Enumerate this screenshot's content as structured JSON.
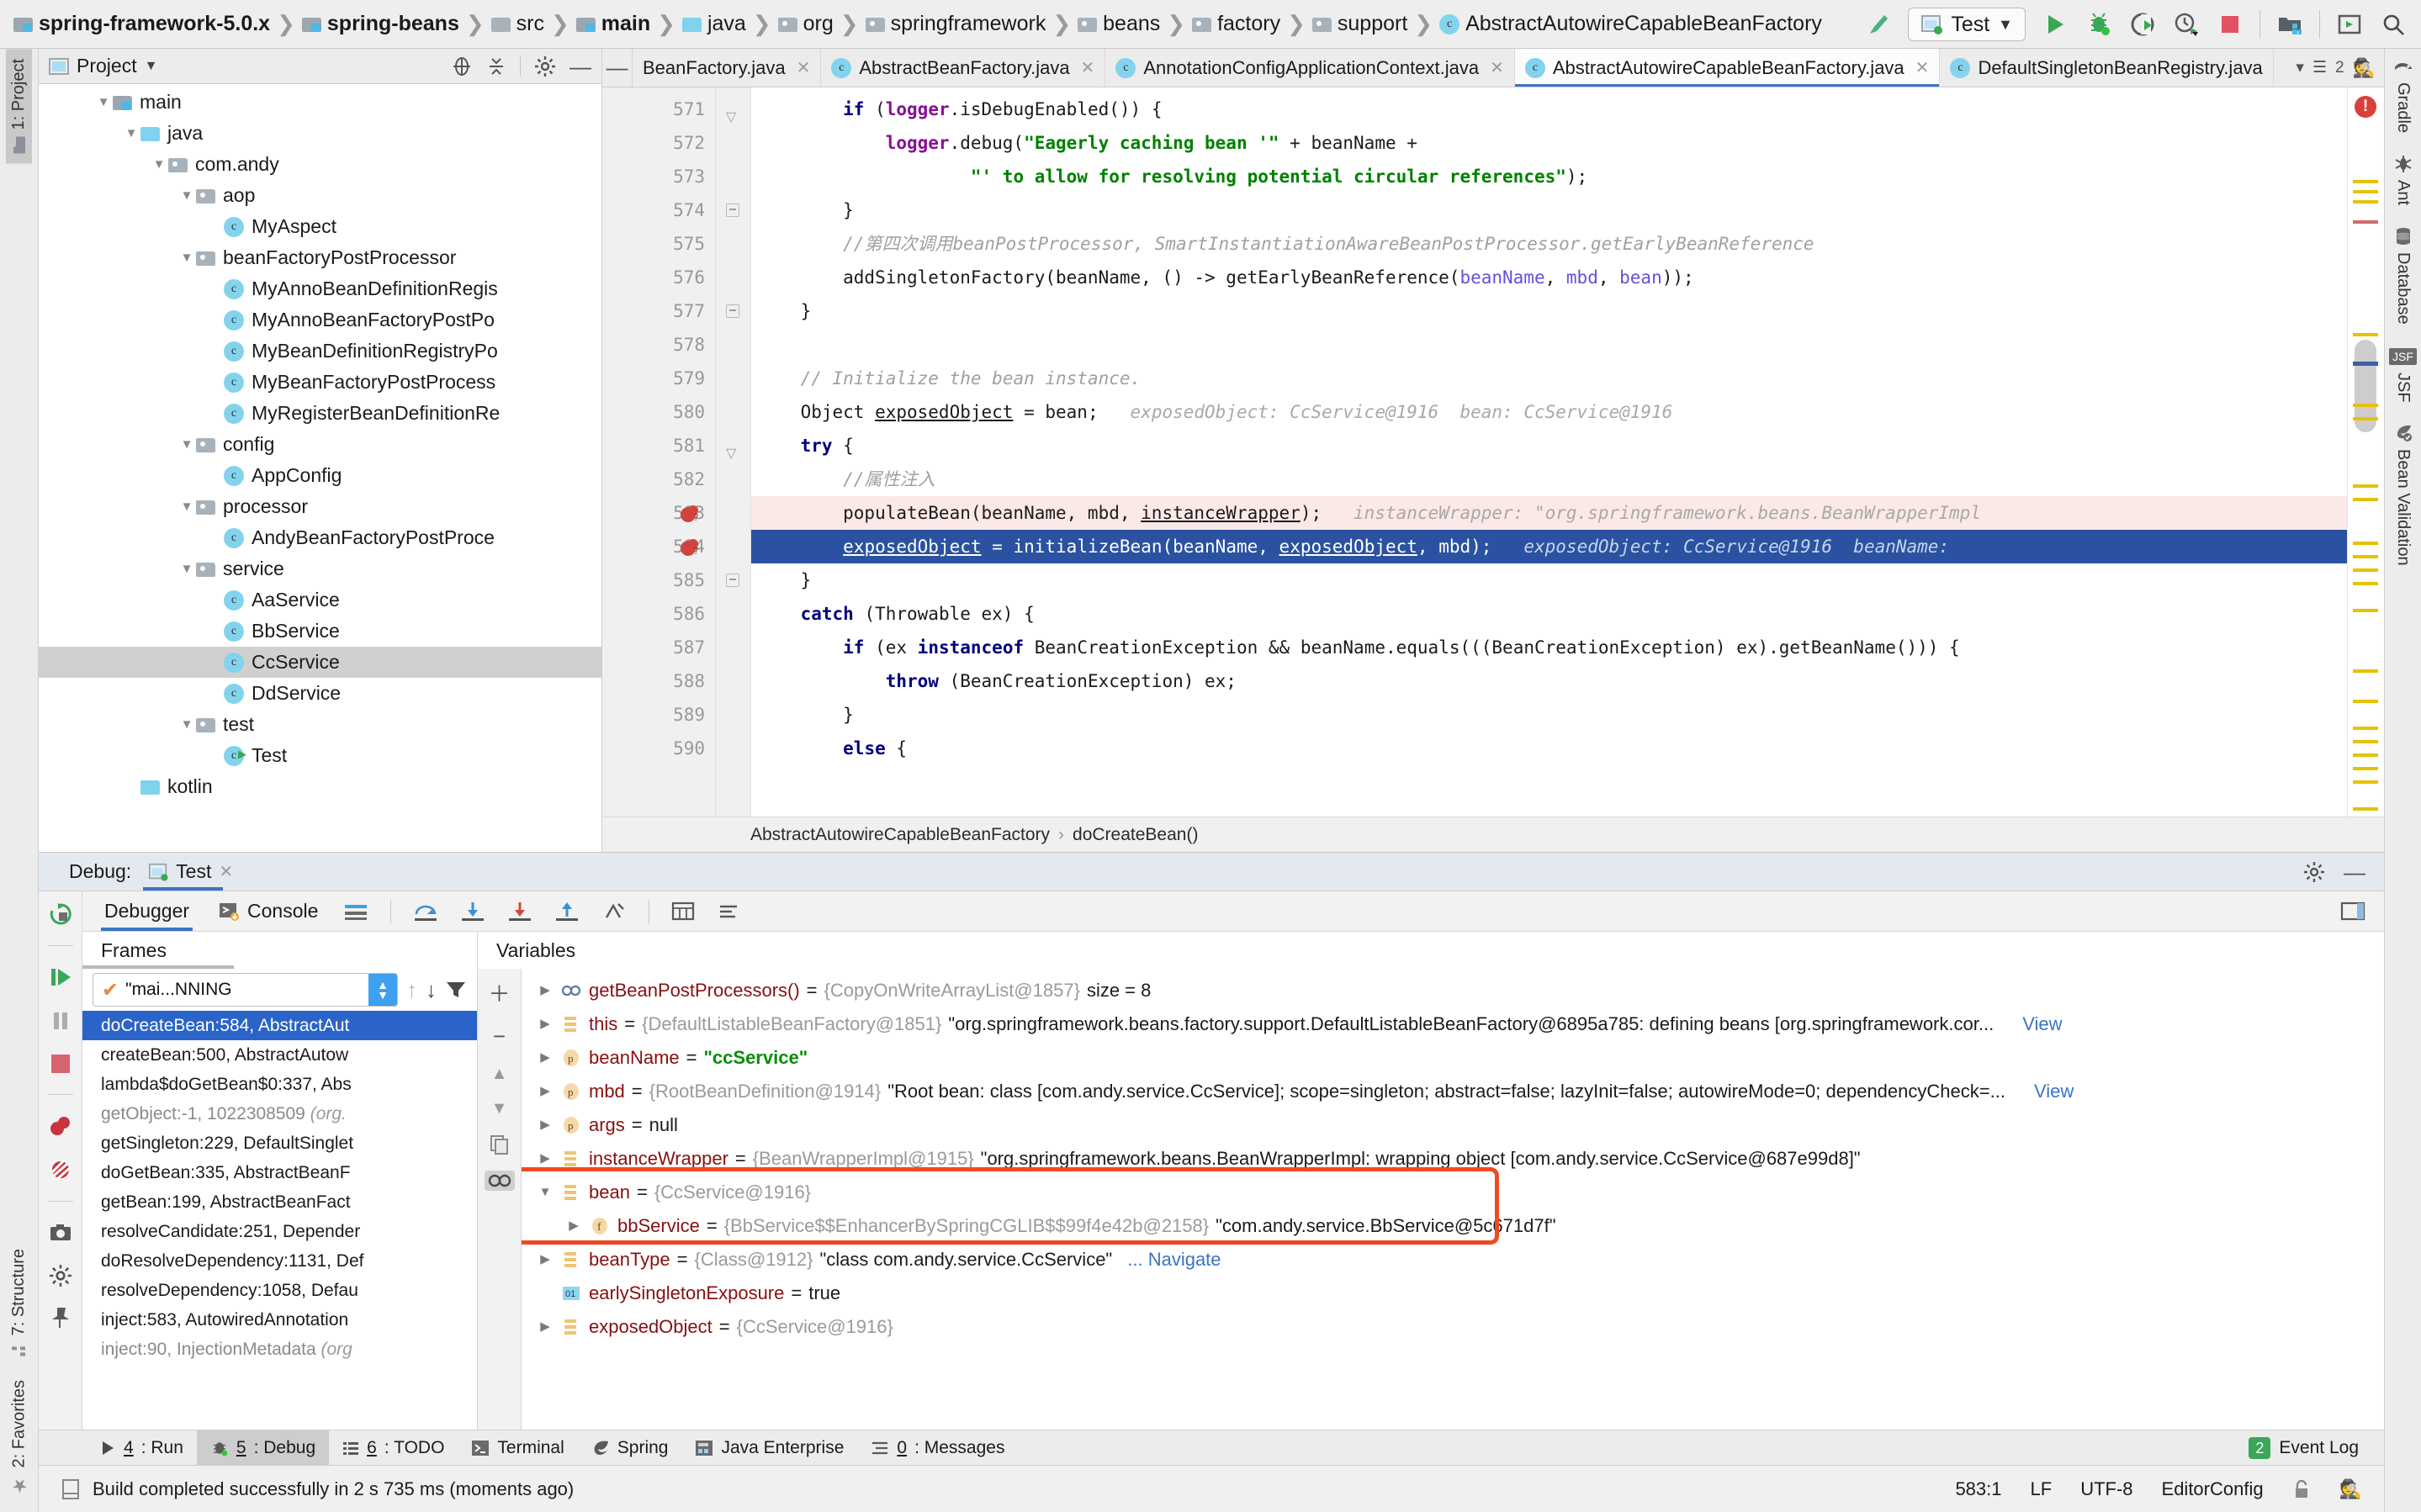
{
  "navbar": {
    "breadcrumbs": [
      {
        "label": "spring-framework-5.0.x",
        "icon": "module-folder-icon",
        "bold": true
      },
      {
        "label": "spring-beans",
        "icon": "module-folder-icon",
        "bold": true
      },
      {
        "label": "src",
        "icon": "folder-icon",
        "bold": false
      },
      {
        "label": "main",
        "icon": "module-folder-icon",
        "bold": true
      },
      {
        "label": "java",
        "icon": "source-folder-icon",
        "bold": false
      },
      {
        "label": "org",
        "icon": "package-folder-icon",
        "bold": false
      },
      {
        "label": "springframework",
        "icon": "package-folder-icon",
        "bold": false
      },
      {
        "label": "beans",
        "icon": "package-folder-icon",
        "bold": false
      },
      {
        "label": "factory",
        "icon": "package-folder-icon",
        "bold": false
      },
      {
        "label": "support",
        "icon": "package-folder-icon",
        "bold": false
      },
      {
        "label": "AbstractAutowireCapableBeanFactory",
        "icon": "class-icon",
        "bold": false
      }
    ],
    "run_config": "Test",
    "buttons": [
      "build-icon",
      "run-config-selector",
      "run-icon",
      "debug-icon",
      "run-with-coverage-icon",
      "profile-icon",
      "stop-icon",
      "project-structure-icon",
      "select-target-icon",
      "search-everywhere-icon"
    ]
  },
  "left_strip": {
    "top_tab": "1: Project",
    "bottom_tabs": [
      "7: Structure",
      "2: Favorites"
    ]
  },
  "right_strip": {
    "tabs": [
      "Gradle",
      "Ant",
      "Database",
      "JSF",
      "Bean Validation"
    ]
  },
  "project_panel": {
    "title": "Project",
    "tree": [
      {
        "label": "main",
        "depth": 2,
        "icon": "module-folder-icon",
        "twist": "▼",
        "selected": false
      },
      {
        "label": "java",
        "depth": 3,
        "icon": "source-folder-icon",
        "twist": "▼",
        "selected": false
      },
      {
        "label": "com.andy",
        "depth": 4,
        "icon": "package-folder-icon",
        "twist": "▼",
        "selected": false
      },
      {
        "label": "aop",
        "depth": 5,
        "icon": "package-folder-icon",
        "twist": "▼",
        "selected": false
      },
      {
        "label": "MyAspect",
        "depth": 6,
        "icon": "class-icon",
        "twist": "",
        "selected": false
      },
      {
        "label": "beanFactoryPostProcessor",
        "depth": 5,
        "icon": "package-folder-icon",
        "twist": "▼",
        "selected": false
      },
      {
        "label": "MyAnnoBeanDefinitionRegis",
        "depth": 6,
        "icon": "class-icon",
        "twist": "",
        "selected": false
      },
      {
        "label": "MyAnnoBeanFactoryPostPo",
        "depth": 6,
        "icon": "class-icon",
        "twist": "",
        "selected": false
      },
      {
        "label": "MyBeanDefinitionRegistryPo",
        "depth": 6,
        "icon": "class-icon",
        "twist": "",
        "selected": false
      },
      {
        "label": "MyBeanFactoryPostProcess",
        "depth": 6,
        "icon": "class-icon",
        "twist": "",
        "selected": false
      },
      {
        "label": "MyRegisterBeanDefinitionRe",
        "depth": 6,
        "icon": "class-icon",
        "twist": "",
        "selected": false
      },
      {
        "label": "config",
        "depth": 5,
        "icon": "package-folder-icon",
        "twist": "▼",
        "selected": false
      },
      {
        "label": "AppConfig",
        "depth": 6,
        "icon": "class-icon",
        "twist": "",
        "selected": false
      },
      {
        "label": "processor",
        "depth": 5,
        "icon": "package-folder-icon",
        "twist": "▼",
        "selected": false
      },
      {
        "label": "AndyBeanFactoryPostProce",
        "depth": 6,
        "icon": "class-icon",
        "twist": "",
        "selected": false
      },
      {
        "label": "service",
        "depth": 5,
        "icon": "package-folder-icon",
        "twist": "▼",
        "selected": false
      },
      {
        "label": "AaService",
        "depth": 6,
        "icon": "class-icon",
        "twist": "",
        "selected": false
      },
      {
        "label": "BbService",
        "depth": 6,
        "icon": "class-icon",
        "twist": "",
        "selected": false
      },
      {
        "label": "CcService",
        "depth": 6,
        "icon": "class-icon",
        "twist": "",
        "selected": true
      },
      {
        "label": "DdService",
        "depth": 6,
        "icon": "class-icon",
        "twist": "",
        "selected": false
      },
      {
        "label": "test",
        "depth": 5,
        "icon": "package-folder-icon",
        "twist": "▼",
        "selected": false
      },
      {
        "label": "Test",
        "depth": 6,
        "icon": "class-runnable-icon",
        "twist": "",
        "selected": false
      },
      {
        "label": "kotlin",
        "depth": 3,
        "icon": "source-folder-icon",
        "twist": "",
        "selected": false
      }
    ]
  },
  "editor": {
    "tabs": [
      {
        "label": "BeanFactory.java",
        "active": false,
        "truncated": true
      },
      {
        "label": "AbstractBeanFactory.java",
        "active": false,
        "truncated": false
      },
      {
        "label": "AnnotationConfigApplicationContext.java",
        "active": false,
        "truncated": false
      },
      {
        "label": "AbstractAutowireCapableBeanFactory.java",
        "active": true,
        "truncated": false
      },
      {
        "label": "DefaultSingletonBeanRegistry.java",
        "active": false,
        "truncated": true
      }
    ],
    "tab_overflow_count": "2",
    "first_line": 571,
    "lines": [
      {
        "n": 571,
        "fold": "tri",
        "bp": false,
        "hl": "",
        "html": "        <span class=\"kw\">if</span> (<span class=\"fld\">logger</span>.isDebugEnabled()) {"
      },
      {
        "n": 572,
        "fold": "",
        "bp": false,
        "hl": "",
        "html": "            <span class=\"fld\">logger</span>.debug(<span class=\"str\">\"Eagerly caching bean '\"</span> + beanName +"
      },
      {
        "n": 573,
        "fold": "",
        "bp": false,
        "hl": "",
        "html": "                    <span class=\"str\">\"' to allow for resolving potential circular references\"</span>);"
      },
      {
        "n": 574,
        "fold": "sq",
        "bp": false,
        "hl": "",
        "html": "        }"
      },
      {
        "n": 575,
        "fold": "",
        "bp": false,
        "hl": "",
        "html": "        <span class=\"cmt\">//第四次调用beanPostProcessor, SmartInstantiationAwareBeanPostProcessor.getEarlyBeanReference</span>"
      },
      {
        "n": 576,
        "fold": "",
        "bp": false,
        "hl": "",
        "html": "        addSingletonFactory(beanName, () -&gt; getEarlyBeanReference(<span class=\"par\">beanName</span>, <span class=\"par\">mbd</span>, <span class=\"par\">bean</span>));"
      },
      {
        "n": 577,
        "fold": "sq",
        "bp": false,
        "hl": "",
        "html": "    }"
      },
      {
        "n": 578,
        "fold": "",
        "bp": false,
        "hl": "",
        "html": ""
      },
      {
        "n": 579,
        "fold": "",
        "bp": false,
        "hl": "",
        "html": "    <span class=\"cmt\">// Initialize the bean instance.</span>"
      },
      {
        "n": 580,
        "fold": "",
        "bp": false,
        "hl": "",
        "html": "    Object <span class=\"und\">exposedObject</span> = bean;   <span class=\"hint\">exposedObject: CcService@1916  bean: CcService@1916</span>"
      },
      {
        "n": 581,
        "fold": "tri",
        "bp": false,
        "hl": "",
        "html": "    <span class=\"kw\">try</span> {"
      },
      {
        "n": 582,
        "fold": "",
        "bp": false,
        "hl": "",
        "html": "        <span class=\"cmt\">//属性注入</span>"
      },
      {
        "n": 583,
        "fold": "",
        "bp": true,
        "hl": "hl-pink",
        "html": "        populateBean(beanName, mbd, <span class=\"und\">instanceWrapper</span>);   <span class=\"hint\">instanceWrapper: \"org.springframework.beans.BeanWrapperImpl</span>"
      },
      {
        "n": 584,
        "fold": "",
        "bp": true,
        "hl": "hl-blue",
        "html": "        <span class=\"und\">exposedObject</span> = initializeBean(beanName, <span class=\"und\">exposedObject</span>, mbd);   <span class=\"hint\">exposedObject: CcService@1916  beanName:</span>"
      },
      {
        "n": 585,
        "fold": "sq",
        "bp": false,
        "hl": "",
        "html": "    }"
      },
      {
        "n": 586,
        "fold": "",
        "bp": false,
        "hl": "",
        "html": "    <span class=\"kw\">catch</span> (Throwable ex) {"
      },
      {
        "n": 587,
        "fold": "",
        "bp": false,
        "hl": "",
        "html": "        <span class=\"kw\">if</span> (ex <span class=\"kw\">instanceof</span> BeanCreationException &amp;&amp; beanName.equals(((BeanCreationException) ex).getBeanName())) {"
      },
      {
        "n": 588,
        "fold": "",
        "bp": false,
        "hl": "",
        "html": "            <span class=\"kw\">throw</span> (BeanCreationException) ex;"
      },
      {
        "n": 589,
        "fold": "",
        "bp": false,
        "hl": "",
        "html": "        }"
      },
      {
        "n": 590,
        "fold": "",
        "bp": false,
        "hl": "",
        "html": "        <span class=\"kw\">else</span> {"
      }
    ],
    "breadcrumb": [
      "AbstractAutowireCapableBeanFactory",
      "doCreateBean()"
    ]
  },
  "debug": {
    "title": "Debug:",
    "run_tab": "Test",
    "tabs": [
      {
        "label": "Debugger",
        "active": true
      },
      {
        "label": "Console",
        "active": false
      }
    ],
    "frames_header": "Frames",
    "variables_header": "Variables",
    "thread_selector": "\"mai...NNING",
    "frames": [
      {
        "label": "doCreateBean:584, AbstractAut",
        "selected": true,
        "dim": false,
        "pkg": ""
      },
      {
        "label": "createBean:500, AbstractAutow",
        "selected": false,
        "dim": false,
        "pkg": ""
      },
      {
        "label": "lambda$doGetBean$0:337, Abs",
        "selected": false,
        "dim": false,
        "pkg": ""
      },
      {
        "label": "getObject:-1, 1022308509 ",
        "selected": false,
        "dim": true,
        "pkg": "(org."
      },
      {
        "label": "getSingleton:229, DefaultSinglet",
        "selected": false,
        "dim": false,
        "pkg": ""
      },
      {
        "label": "doGetBean:335, AbstractBeanF",
        "selected": false,
        "dim": false,
        "pkg": ""
      },
      {
        "label": "getBean:199, AbstractBeanFact",
        "selected": false,
        "dim": false,
        "pkg": ""
      },
      {
        "label": "resolveCandidate:251, Depender",
        "selected": false,
        "dim": false,
        "pkg": ""
      },
      {
        "label": "doResolveDependency:1131, Def",
        "selected": false,
        "dim": false,
        "pkg": ""
      },
      {
        "label": "resolveDependency:1058, Defau",
        "selected": false,
        "dim": false,
        "pkg": ""
      },
      {
        "label": "inject:583, AutowiredAnnotation",
        "selected": false,
        "dim": false,
        "pkg": ""
      },
      {
        "label": "inject:90, InjectionMetadata ",
        "selected": false,
        "dim": true,
        "pkg": "(org"
      }
    ],
    "variables": [
      {
        "twist": "▶",
        "icon": "method-icon",
        "name": "getBeanPostProcessors()",
        "eq": " = ",
        "type": "{CopyOnWriteArrayList@1857}",
        "value": "  size = 8",
        "value_class": "vstr",
        "indent": 0,
        "tail": ""
      },
      {
        "twist": "▶",
        "icon": "field-icon",
        "name": "this",
        "eq": " = ",
        "type": "{DefaultListableBeanFactory@1851}",
        "value": " \"org.springframework.beans.factory.support.DefaultListableBeanFactory@6895a785: defining beans [org.springframework.cor...",
        "value_class": "vstr",
        "indent": 0,
        "tail": "View"
      },
      {
        "twist": "▶",
        "icon": "param-icon",
        "name": "beanName",
        "eq": " = ",
        "type": "",
        "value": "\"ccService\"",
        "value_class": "vstr-green",
        "indent": 0,
        "tail": ""
      },
      {
        "twist": "▶",
        "icon": "param-icon",
        "name": "mbd",
        "eq": " = ",
        "type": "{RootBeanDefinition@1914}",
        "value": " \"Root bean: class [com.andy.service.CcService]; scope=singleton; abstract=false; lazyInit=false; autowireMode=0; dependencyCheck=...",
        "value_class": "vstr",
        "indent": 0,
        "tail": "View"
      },
      {
        "twist": "▶",
        "icon": "param-icon",
        "name": "args",
        "eq": " = ",
        "type": "",
        "value": "null",
        "value_class": "vstr",
        "indent": 0,
        "tail": ""
      },
      {
        "twist": "▶",
        "icon": "field-icon",
        "name": "instanceWrapper",
        "eq": " = ",
        "type": "{BeanWrapperImpl@1915}",
        "value": " \"org.springframework.beans.BeanWrapperImpl: wrapping object [com.andy.service.CcService@687e99d8]\"",
        "value_class": "vstr",
        "indent": 0,
        "tail": ""
      },
      {
        "twist": "▼",
        "icon": "field-icon",
        "name": "bean",
        "eq": " = ",
        "type": "{CcService@1916}",
        "value": "",
        "value_class": "vstr",
        "indent": 0,
        "tail": ""
      },
      {
        "twist": "▶",
        "icon": "field-f-icon",
        "name": "bbService",
        "eq": " = ",
        "type": "{BbService$$EnhancerBySpringCGLIB$$99f4e42b@2158}",
        "value": " \"com.andy.service.BbService@5c671d7f\"",
        "value_class": "vstr",
        "indent": 1,
        "tail": ""
      },
      {
        "twist": "▶",
        "icon": "field-icon",
        "name": "beanType",
        "eq": " = ",
        "type": "{Class@1912}",
        "value": " \"class com.andy.service.CcService\"",
        "value_class": "vstr",
        "indent": 0,
        "tail": "Navigate"
      },
      {
        "twist": "",
        "icon": "bool-icon",
        "name": "earlySingletonExposure",
        "eq": " = ",
        "type": "",
        "value": "true",
        "value_class": "vstr",
        "indent": 0,
        "tail": ""
      },
      {
        "twist": "▶",
        "icon": "field-icon",
        "name": "exposedObject",
        "eq": " = ",
        "type": "{CcService@1916}",
        "value": "",
        "value_class": "vstr",
        "indent": 0,
        "tail": ""
      }
    ],
    "view_label": "View",
    "navigate_label": "... Navigate",
    "highlight_color": "#ef4923"
  },
  "toolwindows": {
    "items": [
      {
        "num": "4",
        "label": ": Run",
        "icon": "run-icon",
        "active": false
      },
      {
        "num": "5",
        "label": ": Debug",
        "icon": "debug-icon",
        "active": true
      },
      {
        "num": "6",
        "label": ": TODO",
        "icon": "todo-icon",
        "active": false
      },
      {
        "num": "",
        "label": "Terminal",
        "icon": "terminal-icon",
        "active": false
      },
      {
        "num": "",
        "label": "Spring",
        "icon": "spring-icon",
        "active": false
      },
      {
        "num": "",
        "label": "Java Enterprise",
        "icon": "java-enterprise-icon",
        "active": false
      },
      {
        "num": "0",
        "label": ": Messages",
        "icon": "messages-icon",
        "active": false
      }
    ],
    "event_log": "Event Log",
    "event_log_count": "2"
  },
  "statusbar": {
    "message": "Build completed successfully in 2 s 735 ms (moments ago)",
    "caret": "583:1",
    "line_sep": "LF",
    "encoding": "UTF-8",
    "editorconfig": "EditorConfig"
  }
}
